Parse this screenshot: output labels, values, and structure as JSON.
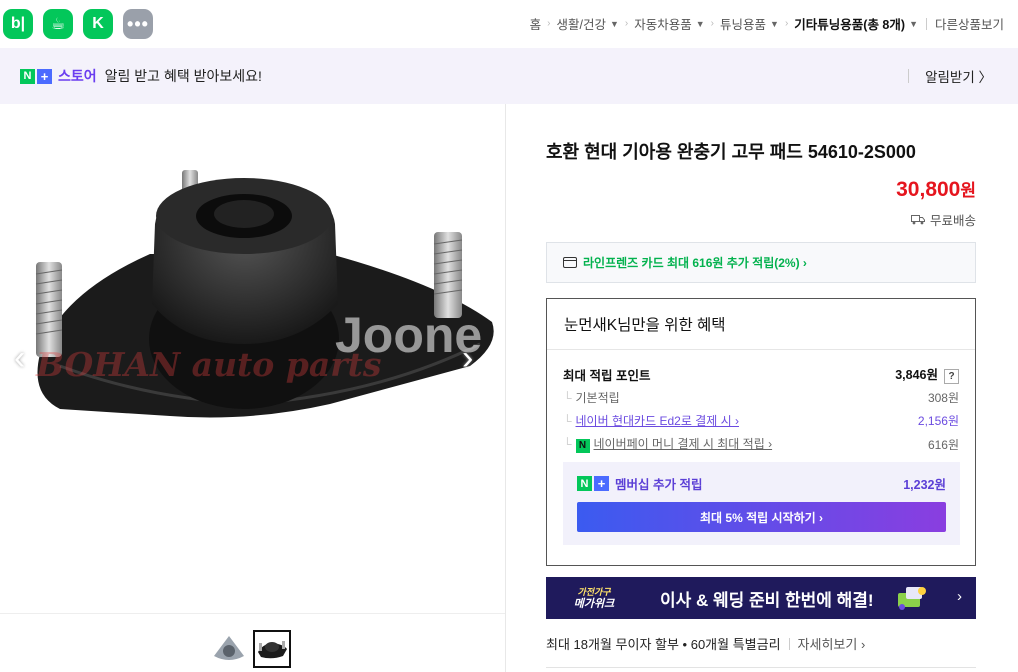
{
  "top_apps": [
    {
      "name": "blog",
      "glyph": "b|"
    },
    {
      "name": "cafe",
      "glyph": "☕"
    },
    {
      "name": "kream",
      "glyph": "K"
    },
    {
      "name": "more",
      "glyph": "•••"
    }
  ],
  "breadcrumb": {
    "home": "홈",
    "items": [
      "생활/건강",
      "자동차용품",
      "튜닝용품"
    ],
    "current": "기타튜닝용품(총 8개)",
    "other": "다른상품보기"
  },
  "notice": {
    "brand_n": "N",
    "brand_plus": "+",
    "store_label": "스토어",
    "text": "알림 받고 혜택 받아보세요!",
    "button": "알림받기 〉"
  },
  "gallery": {
    "watermark_joone": "Joone",
    "watermark_bohan": "BOHAN auto parts",
    "prev": "‹",
    "next": "›"
  },
  "product": {
    "title": "호환 현대 기아용 완충기 고무 패드 54610-2S000",
    "price": "30,800",
    "price_unit": "원",
    "shipping": "무료배송"
  },
  "card_promo": {
    "text": "라인프렌즈 카드 최대 616원 추가 적립(2%) ›"
  },
  "benefit": {
    "heading": "눈먼새K님만을 위한 혜택",
    "max_points_label": "최대 적립 포인트",
    "max_points_value": "3,846원",
    "help": "?",
    "rows": [
      {
        "label": "기본적립",
        "value": "308원"
      },
      {
        "label": "네이버 현대카드 Ed2로 결제 시 ›",
        "value": "2,156원"
      },
      {
        "label": "네이버페이 머니 결제 시 최대 적립 ›",
        "value": "616원"
      }
    ],
    "npay_badge": "N",
    "membership_label": "멤버십 추가 적립",
    "membership_value": "1,232원",
    "membership_button": "최대 5% 적립 시작하기 ›"
  },
  "banner": {
    "brand_top": "가전가구",
    "brand_bottom": "메가위크",
    "text": "이사 & 웨딩 준비 한번에 해결!",
    "arrow": "›"
  },
  "installment": {
    "text": "최대 18개월 무이자 할부 • 60개월 특별금리",
    "more": "자세히보기 ›"
  },
  "colors": {
    "naver_green": "#03c75a",
    "price_red": "#e5151e",
    "membership_purple": "#5b3fd6",
    "banner_navy": "#1f1a5c"
  }
}
